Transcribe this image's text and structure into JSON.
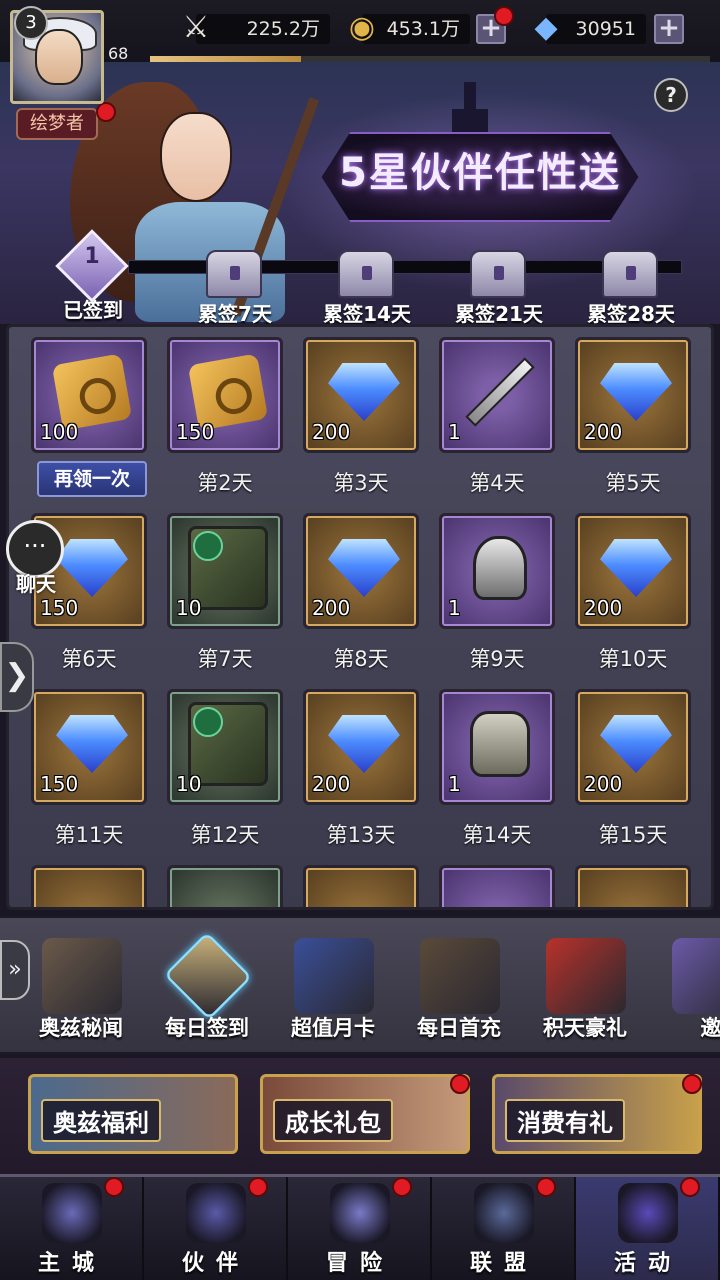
{
  "player": {
    "vip_level": "3",
    "level": "68",
    "title": "绘梦者",
    "exp_fraction": 0.27
  },
  "resources": {
    "power": {
      "icon": "sword-wings-icon",
      "value": "225.2万"
    },
    "gold": {
      "icon": "gold-coin-icon",
      "value": "453.1万"
    },
    "gems": {
      "icon": "diamond-icon",
      "value": "30951"
    }
  },
  "banner": {
    "title": "5星伙伴任性送",
    "help": "?",
    "signed_count": "1",
    "signed_label": "已签到",
    "milestones": [
      "累签7天",
      "累签14天",
      "累签21天",
      "累签28天"
    ]
  },
  "claim_again": "再领一次",
  "rewards": [
    {
      "item": "scroll-icon",
      "frame": "purple",
      "qty": "100",
      "label": ""
    },
    {
      "item": "scroll-icon",
      "frame": "purple",
      "qty": "150",
      "label": "第2天"
    },
    {
      "item": "diamond-icon",
      "frame": "gold",
      "qty": "200",
      "label": "第3天"
    },
    {
      "item": "sword-icon",
      "frame": "purple",
      "qty": "1",
      "label": "第4天"
    },
    {
      "item": "diamond-icon",
      "frame": "gold",
      "qty": "200",
      "label": "第5天"
    },
    {
      "item": "diamond-icon",
      "frame": "gold",
      "qty": "150",
      "label": "第6天"
    },
    {
      "item": "hero-shard-icon",
      "frame": "green",
      "qty": "10",
      "label": "第7天"
    },
    {
      "item": "diamond-icon",
      "frame": "gold",
      "qty": "200",
      "label": "第8天"
    },
    {
      "item": "helmet-icon",
      "frame": "purple",
      "qty": "1",
      "label": "第9天"
    },
    {
      "item": "diamond-icon",
      "frame": "gold",
      "qty": "200",
      "label": "第10天"
    },
    {
      "item": "diamond-icon",
      "frame": "gold",
      "qty": "150",
      "label": "第11天"
    },
    {
      "item": "hero-shard-icon",
      "frame": "green",
      "qty": "10",
      "label": "第12天"
    },
    {
      "item": "diamond-icon",
      "frame": "gold",
      "qty": "200",
      "label": "第13天"
    },
    {
      "item": "armor-icon",
      "frame": "purple",
      "qty": "1",
      "label": "第14天"
    },
    {
      "item": "diamond-icon",
      "frame": "gold",
      "qty": "200",
      "label": "第15天"
    }
  ],
  "side": {
    "chat_label": "聊天",
    "chat_icon": "chat-bubble-icon",
    "expand_arrow": "❯"
  },
  "activity_tabs": [
    {
      "label": "奥兹秘闻",
      "icon": "scarecrow-icon",
      "active": false
    },
    {
      "label": "每日签到",
      "icon": "quill-scroll-icon",
      "active": true
    },
    {
      "label": "超值月卡",
      "icon": "month-card-icon",
      "active": false
    },
    {
      "label": "每日首充",
      "icon": "witch-hat-icon",
      "active": false
    },
    {
      "label": "积天豪礼",
      "icon": "gift-box-icon",
      "active": false
    },
    {
      "label": "邀",
      "icon": "crystal-icon",
      "active": false
    }
  ],
  "tabs_arrow": "»",
  "promos": [
    {
      "label": "奥兹福利",
      "dot": false
    },
    {
      "label": "成长礼包",
      "dot": true
    },
    {
      "label": "消费有礼",
      "dot": true
    }
  ],
  "nav": [
    {
      "label": "主城",
      "icon": "castle-icon",
      "dot": true
    },
    {
      "label": "伙伴",
      "icon": "hat-icon",
      "dot": true
    },
    {
      "label": "冒险",
      "icon": "crystal-orb-icon",
      "dot": true
    },
    {
      "label": "联盟",
      "icon": "shield-icon",
      "dot": true
    },
    {
      "label": "活动",
      "icon": "cards-icon",
      "dot": true
    }
  ],
  "colors": {
    "accent_purple": "#8a5cc8",
    "gold_frame": "#d5aa5e",
    "notice_red": "#e01b24"
  }
}
